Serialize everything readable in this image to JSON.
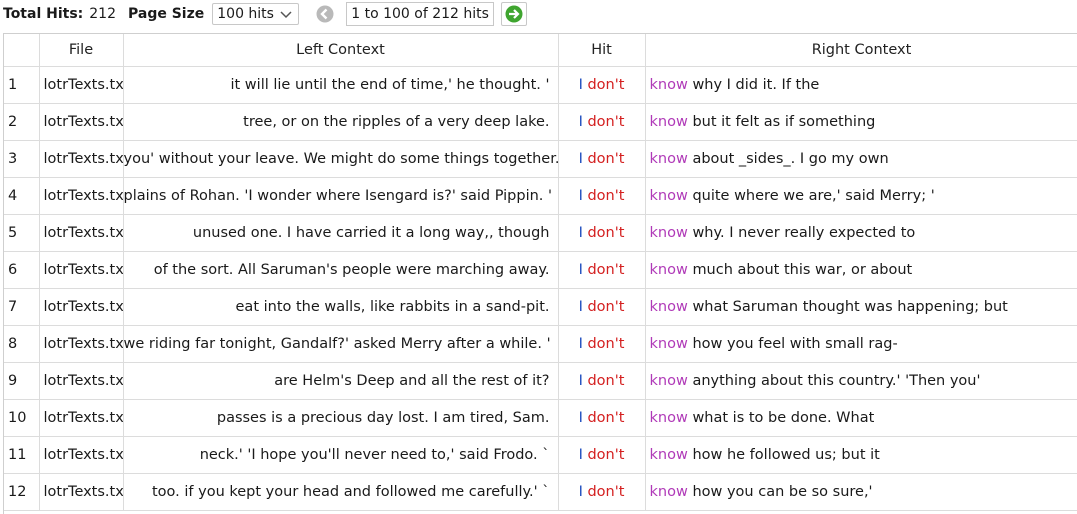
{
  "toolbar": {
    "total_hits_label": "Total Hits:",
    "total_hits_value": "212",
    "page_size_label": "Page Size",
    "page_size_value": "100 hits",
    "page_range": "1 to 100 of 212 hits",
    "prev_icon": "back-arrow-icon",
    "next_icon": "forward-arrow-icon"
  },
  "table": {
    "columns": [
      "",
      "File",
      "Left Context",
      "Hit",
      "Right Context"
    ],
    "rows": [
      {
        "n": "1",
        "file": "lotrTexts.txt",
        "left": "it will lie until the end of time,' he thought. '",
        "hit_a": "I",
        "hit_b": "don't",
        "kw": "know",
        "right": "why I did it. If the"
      },
      {
        "n": "2",
        "file": "lotrTexts.txt",
        "left": "tree, or on the ripples of a very deep lake.",
        "hit_a": "I",
        "hit_b": "don't",
        "kw": "know",
        "right": "but it felt as if something"
      },
      {
        "n": "3",
        "file": "lotrTexts.txt",
        "left": "you' without your leave. We might do some things together.",
        "hit_a": "I",
        "hit_b": "don't",
        "kw": "know",
        "right": "about _sides_. I go my own"
      },
      {
        "n": "4",
        "file": "lotrTexts.txt",
        "left": "plains of Rohan. 'I wonder where Isengard is?' said Pippin. '",
        "hit_a": "I",
        "hit_b": "don't",
        "kw": "know",
        "right": "quite where we are,' said Merry; '"
      },
      {
        "n": "5",
        "file": "lotrTexts.txt",
        "left": "unused one. I have carried it a long way,, though",
        "hit_a": "I",
        "hit_b": "don't",
        "kw": "know",
        "right": "why. I never really expected to"
      },
      {
        "n": "6",
        "file": "lotrTexts.txt",
        "left": "of the sort. All Saruman's people were marching away.",
        "hit_a": "I",
        "hit_b": "don't",
        "kw": "know",
        "right": "much about this war, or about"
      },
      {
        "n": "7",
        "file": "lotrTexts.txt",
        "left": "eat into the walls, like rabbits in a sand-pit.",
        "hit_a": "I",
        "hit_b": "don't",
        "kw": "know",
        "right": "what Saruman thought was happening; but"
      },
      {
        "n": "8",
        "file": "lotrTexts.txt",
        "left": "we riding far tonight, Gandalf?' asked Merry after a while. '",
        "hit_a": "I",
        "hit_b": "don't",
        "kw": "know",
        "right": "how you feel with small rag-"
      },
      {
        "n": "9",
        "file": "lotrTexts.txt",
        "left": "are Helm's Deep and all the rest of it?",
        "hit_a": "I",
        "hit_b": "don't",
        "kw": "know",
        "right": "anything about this country.' 'Then you'"
      },
      {
        "n": "10",
        "file": "lotrTexts.txt",
        "left": "passes is a precious day lost. I am tired, Sam.",
        "hit_a": "I",
        "hit_b": "don't",
        "kw": "know",
        "right": "what is to be done. What"
      },
      {
        "n": "11",
        "file": "lotrTexts.txt",
        "left": "neck.' 'I hope you'll never need to,' said Frodo. `",
        "hit_a": "I",
        "hit_b": "don't",
        "kw": "know",
        "right": "how he followed us; but it"
      },
      {
        "n": "12",
        "file": "lotrTexts.txt",
        "left": "too. if you kept your head and followed me carefully.' `",
        "hit_a": "I",
        "hit_b": "don't",
        "kw": "know",
        "right": "how you can be so sure,'"
      }
    ]
  }
}
